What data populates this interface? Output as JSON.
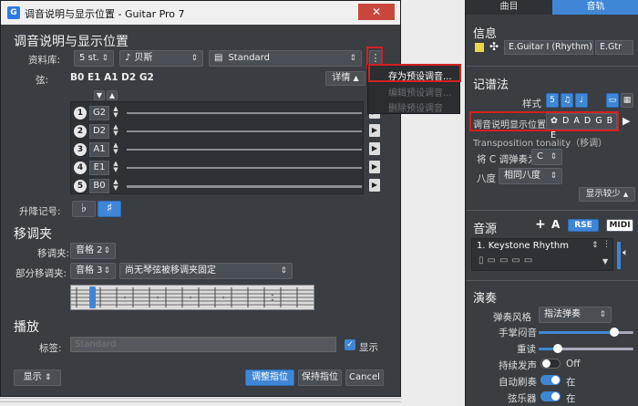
{
  "dialog": {
    "title": "调音说明与显示位置 - Guitar Pro 7",
    "close_glyph": "✕",
    "app_icon": "G",
    "heading": "调音说明与显示位置",
    "library_label": "资料库:",
    "strings_combo": "5 st.",
    "instrument_combo": "贝斯",
    "tuning_combo": "Standard",
    "more_glyph": "⋮",
    "strings_label": "弦:",
    "tuning_notes": "B0 E1 A1 D2 G2",
    "details_button": "详情",
    "strings": [
      {
        "num": "1",
        "note": "G2"
      },
      {
        "num": "2",
        "note": "D2"
      },
      {
        "num": "3",
        "note": "A1"
      },
      {
        "num": "4",
        "note": "E1"
      },
      {
        "num": "5",
        "note": "B0"
      }
    ],
    "accidental_label": "升降记号:",
    "flat_glyph": "♭",
    "sharp_glyph": "♯",
    "capo_heading": "移调夹",
    "capo_label": "移调夹:",
    "capo_value": "音格 2",
    "partial_capo_label": "部分移调夹:",
    "partial_capo_value": "音格 3",
    "partial_capo_mode": "尚无琴弦被移调夹固定",
    "playback_heading": "播放",
    "label_label": "标签:",
    "label_placeholder": "Standard",
    "show_label": "显示",
    "show_button": "显示",
    "adjust_button": "调整指位",
    "keep_button": "保持指位",
    "cancel_button": "Cancel"
  },
  "context_menu": {
    "items": [
      "存为预设调音...",
      "编辑预设调音...",
      "删除预设调音"
    ]
  },
  "right_panel": {
    "tabs": [
      "曲目",
      "音轨"
    ],
    "info_heading": "信息",
    "track_name": "E.Guitar I (Rhythm)",
    "track_short": "E.Gtr",
    "notation_heading": "记谱法",
    "style_label": "样式",
    "tuning_display_label": "调音说明显示位置",
    "tuning_display_value": "D A D G B E",
    "transposition_label": "Transposition tonality（移调）",
    "play_c_as_label": "将 C 调弹奏为",
    "play_c_as_value": "C",
    "octave_label": "八度",
    "octave_value": "相同八度",
    "show_less_button": "显示较少",
    "sound_heading": "音源",
    "rse_button": "RSE",
    "midi_button": "MIDI",
    "sound_name": "1. Keystone Rhythm",
    "performance_heading": "演奏",
    "strum_label": "弹奏风格",
    "strum_value": "指法弹奏",
    "palm_mute_label": "手掌闷音",
    "palm_mute_level": 0.8,
    "accent_label": "重读",
    "accent_level": 0.2,
    "sustain_label": "持续发声",
    "sustain_value": "Off",
    "auto_brush_label": "自动刷奏",
    "auto_brush_value": "在",
    "string_noise_label": "弦乐器",
    "string_noise_value": "在"
  },
  "colors": {
    "accent": "#3f86d6",
    "highlight": "#d32020",
    "panel": "#3a3d42"
  }
}
